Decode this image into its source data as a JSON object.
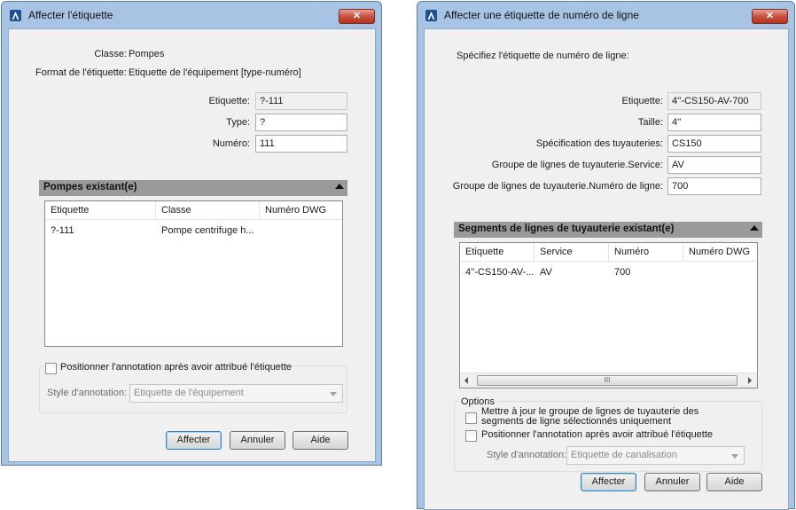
{
  "dialog1": {
    "title": "Affecter l'étiquette",
    "close_icon": "close-x",
    "class_label": "Classe:",
    "class_value": "Pompes",
    "format_label": "Format de l'étiquette:",
    "format_value": "Etiquette de l'équipement [type-numéro]",
    "etiquette_label": "Etiquette:",
    "etiquette_value": "?-111",
    "type_label": "Type:",
    "type_value": "?",
    "numero_label": "Numéro:",
    "numero_value": "111",
    "section_title": "Pompes existant(e)",
    "table": {
      "columns": [
        "Etiquette",
        "Classe",
        "Numéro DWG"
      ],
      "rows": [
        [
          "?-111",
          "Pompe centrifuge h...",
          ""
        ]
      ]
    },
    "position_checkbox_label": "Positionner l'annotation après avoir attribué l'étiquette",
    "annotation_style_label": "Style d'annotation:",
    "annotation_style_value": "Etiquette de l'équipement",
    "buttons": {
      "assign": "Affecter",
      "cancel": "Annuler",
      "help": "Aide"
    }
  },
  "dialog2": {
    "title": "Affecter une étiquette de numéro de ligne",
    "close_icon": "close-x",
    "instruction": "Spécifiez l'étiquette de numéro de ligne:",
    "fields": [
      {
        "label": "Etiquette:",
        "value": "4''-CS150-AV-700"
      },
      {
        "label": "Taille:",
        "value": "4''"
      },
      {
        "label": "Spécification des tuyauteries:",
        "value": "CS150"
      },
      {
        "label": "Groupe de lignes de tuyauterie.Service:",
        "value": "AV"
      },
      {
        "label": "Groupe de lignes de tuyauterie.Numéro de ligne:",
        "value": "700"
      }
    ],
    "section_title": "Segments de lignes de tuyauterie existant(e)",
    "table": {
      "columns": [
        "Etiquette",
        "Service",
        "Numéro",
        "Numéro DWG"
      ],
      "rows": [
        [
          "4''-CS150-AV-...",
          "AV",
          "700",
          ""
        ]
      ]
    },
    "scroll_thumb": "III",
    "options_label": "Options",
    "update_checkbox_label": "Mettre à jour le groupe de lignes de tuyauterie des segments de ligne sélectionnés uniquement",
    "position_checkbox_label": "Positionner l'annotation après avoir attribué l'étiquette",
    "annotation_style_label": "Style d'annotation:",
    "annotation_style_value": "Etiquette de canalisation",
    "buttons": {
      "assign": "Affecter",
      "cancel": "Annuler",
      "help": "Aide"
    }
  }
}
